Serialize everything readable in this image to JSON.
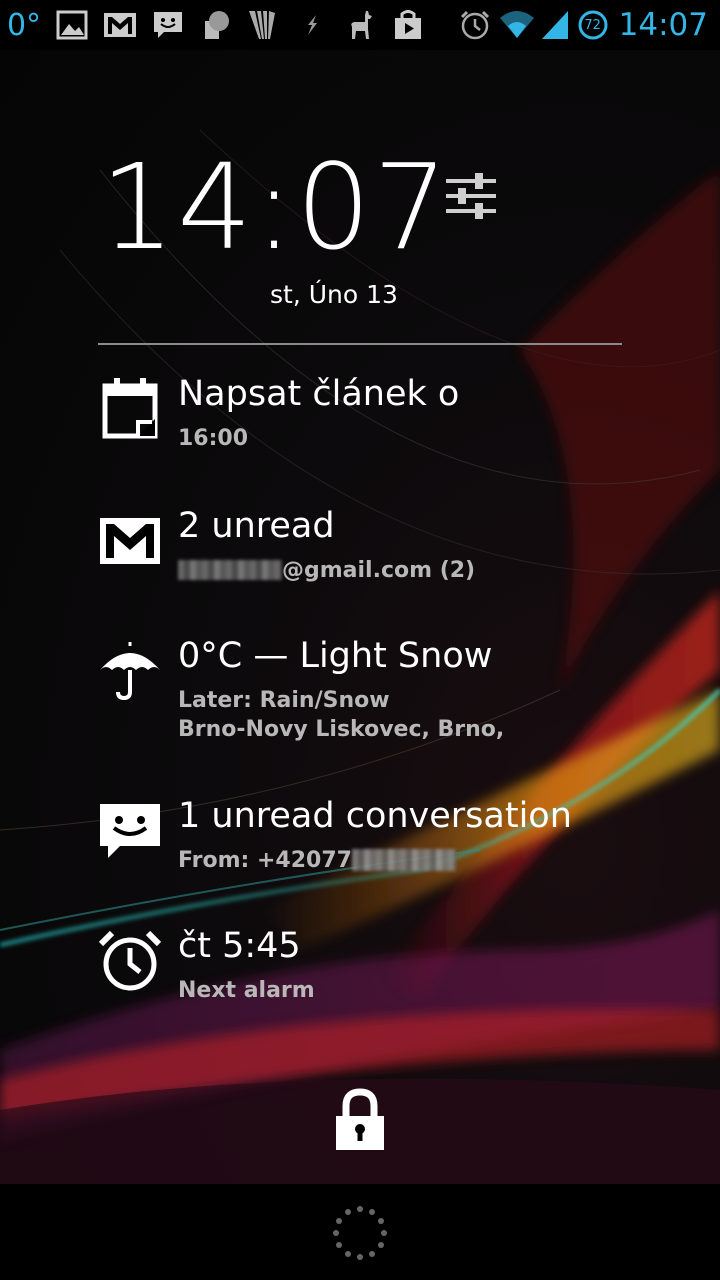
{
  "status_bar": {
    "temperature": "0°",
    "time": "14:07",
    "battery_level": "72",
    "accent_color": "#33b5e5",
    "left_icons": [
      "temperature-icon",
      "gallery-icon",
      "gmail-icon",
      "messaging-icon",
      "contact-icon",
      "app-icon",
      "lightning-icon",
      "llama-icon",
      "play-store-icon"
    ],
    "right_icons": [
      "alarm-icon",
      "wifi-icon",
      "signal-icon",
      "battery-icon"
    ]
  },
  "lockscreen": {
    "clock": "14:07",
    "date": "st, Úno 13",
    "settings_icon": "sliders-icon"
  },
  "widgets": [
    {
      "icon": "calendar-icon",
      "title": "Napsat článek o",
      "subtitle": "16:00"
    },
    {
      "icon": "gmail-icon",
      "title": "2 unread",
      "subtitle": "@gmail.com (2)"
    },
    {
      "icon": "umbrella-icon",
      "title": "0°C — Light Snow",
      "subtitle": "Later: Rain/Snow",
      "subtitle2": "Brno-Novy Liskovec, Brno,"
    },
    {
      "icon": "sms-icon",
      "title": "1 unread conversation",
      "subtitle": "From: +42077"
    },
    {
      "icon": "alarm-icon",
      "title": "čt 5:45",
      "subtitle": "Next alarm"
    }
  ],
  "lock_icon": "lock-icon",
  "nav": {
    "icon": "loading-spinner-icon"
  }
}
